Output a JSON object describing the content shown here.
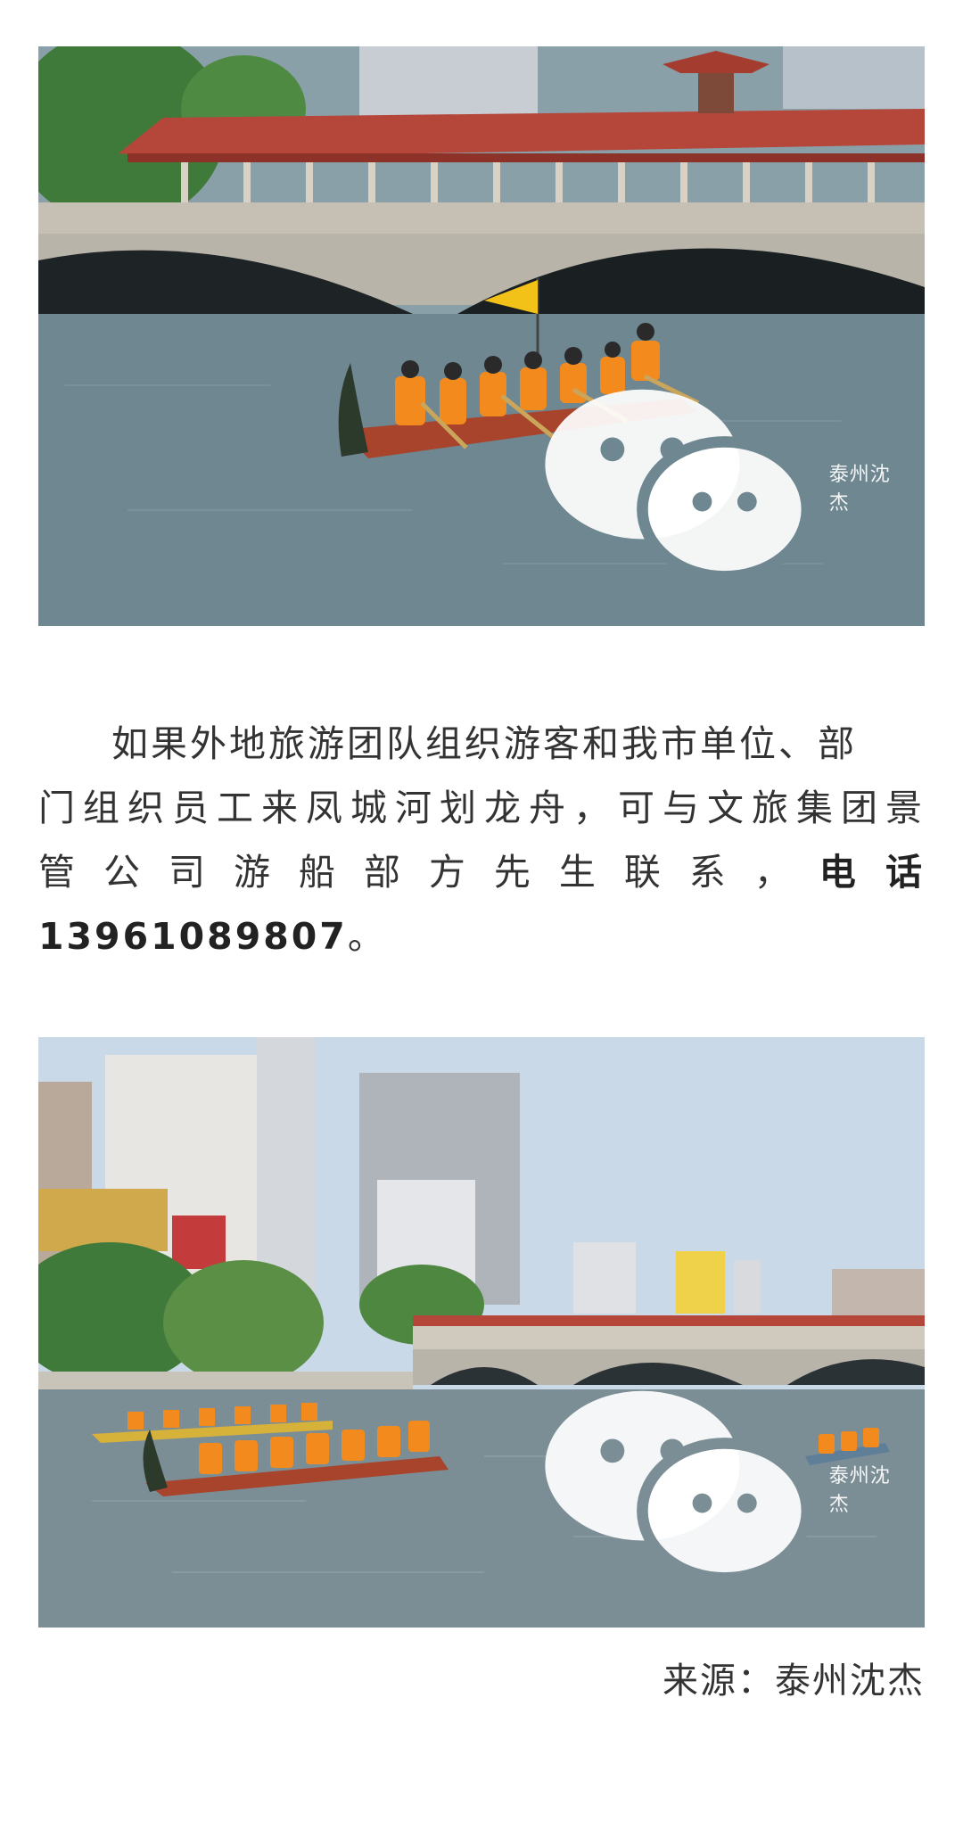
{
  "photos": [
    {
      "subject": "dragon-boat-under-bridge",
      "watermark": "泰州沈杰"
    },
    {
      "subject": "dragon-boats-city-skyline",
      "watermark": "泰州沈杰"
    }
  ],
  "article": {
    "line1": "如果外地旅游团队组织游客和我市单位、部",
    "line2": "门组织员工来凤城河划龙舟，可与文旅集团景",
    "line3_text": "管 公 司 游 船 部 方 先 生 联 系 ，",
    "line3_bold": "电 话",
    "line4_bold": "13961089807",
    "line4_tail": "。"
  },
  "source": {
    "label": "来源：",
    "value": "泰州沈杰"
  },
  "colors": {
    "text": "#333333",
    "water": "#6f8791",
    "bridge": "#b9b4aa",
    "roof": "#b5473a",
    "vest": "#f28a1e",
    "sky": "#c9d9e8"
  },
  "icons": [
    "wechat-icon"
  ]
}
